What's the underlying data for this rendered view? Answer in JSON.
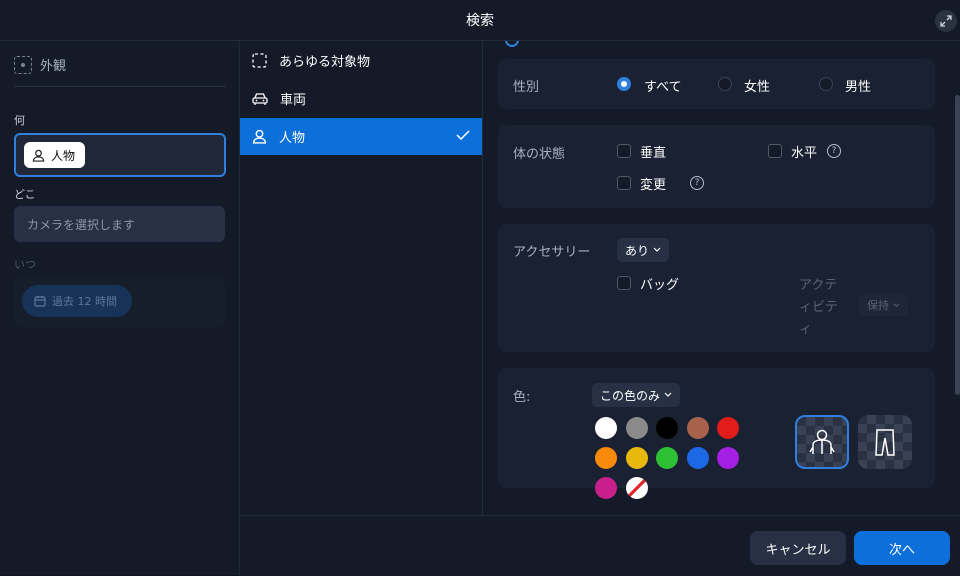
{
  "window": {
    "title": "検索"
  },
  "left": {
    "section_title": "外観",
    "what_label": "何",
    "what_chip": "人物",
    "where_label": "どこ",
    "where_placeholder": "カメラを選択します",
    "when_label": "いつ",
    "when_value": "過去 12 時間"
  },
  "object_types": [
    {
      "label": "あらゆる対象物",
      "icon": "dashed-square-icon",
      "selected": false
    },
    {
      "label": "車両",
      "icon": "car-icon",
      "selected": false
    },
    {
      "label": "人物",
      "icon": "person-icon",
      "selected": true
    }
  ],
  "gender": {
    "label": "性別",
    "options": [
      {
        "label": "すべて",
        "selected": true
      },
      {
        "label": "女性",
        "selected": false
      },
      {
        "label": "男性",
        "selected": false
      }
    ]
  },
  "body_state": {
    "label": "体の状態",
    "options": [
      {
        "label": "垂直",
        "help": false
      },
      {
        "label": "水平",
        "help": true
      },
      {
        "label": "変更",
        "help": true
      }
    ]
  },
  "accessory": {
    "label": "アクセサリー",
    "value": "あり",
    "bag_label": "バッグ",
    "activity_label": "アクティビティ",
    "activity_value": "保持"
  },
  "color": {
    "label": "色:",
    "mode": "この色のみ",
    "swatches": [
      "#ffffff",
      "#8a8a8a",
      "#000000",
      "#a9614c",
      "#e21b1b",
      "#f7890b",
      "#e9b80d",
      "#2ec035",
      "#1d68e6",
      "#a51fe4",
      "#c81f8c",
      "none"
    ],
    "targets": [
      {
        "icon": "upper-body-icon",
        "selected": true
      },
      {
        "icon": "pants-icon",
        "selected": false
      }
    ]
  },
  "footer": {
    "cancel": "キャンセル",
    "next": "次へ"
  },
  "colors": {
    "accent": "#2f7fe0",
    "selected_row": "#0d6fd9",
    "background": "#141a27"
  }
}
